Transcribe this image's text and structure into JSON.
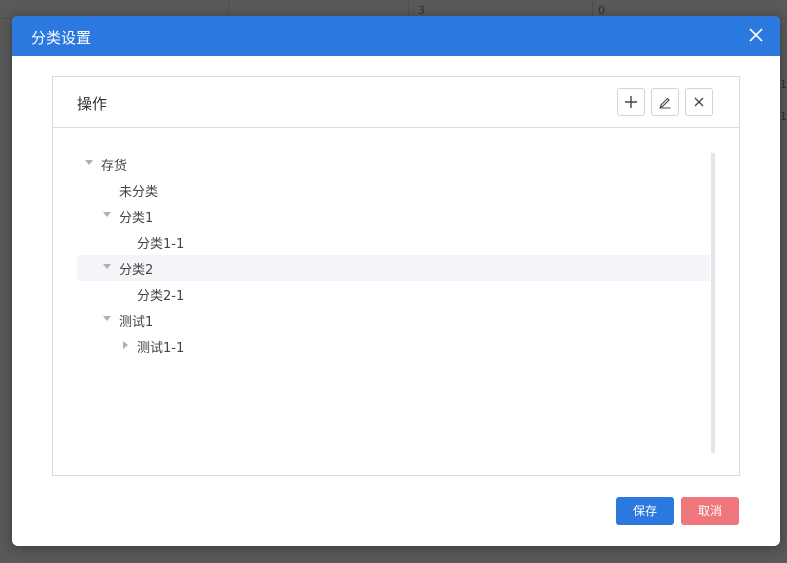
{
  "background": {
    "cells": [
      "3",
      "0",
      "1",
      "1"
    ]
  },
  "dialog": {
    "title": "分类设置",
    "panel_title": "操作",
    "toolbar": {
      "add_icon": "plus-icon",
      "edit_icon": "pencil-icon",
      "delete_icon": "close-icon"
    },
    "tree": [
      {
        "label": "存货",
        "level": 0,
        "toggle": "expanded",
        "highlighted": false
      },
      {
        "label": "未分类",
        "level": 1,
        "toggle": "none",
        "highlighted": false
      },
      {
        "label": "分类1",
        "level": 1,
        "toggle": "expanded",
        "highlighted": false
      },
      {
        "label": "分类1-1",
        "level": 2,
        "toggle": "none",
        "highlighted": false
      },
      {
        "label": "分类2",
        "level": 1,
        "toggle": "expanded",
        "highlighted": true
      },
      {
        "label": "分类2-1",
        "level": 2,
        "toggle": "none",
        "highlighted": false
      },
      {
        "label": "测试1",
        "level": 1,
        "toggle": "expanded",
        "highlighted": false
      },
      {
        "label": "测试1-1",
        "level": 2,
        "toggle": "collapsed",
        "highlighted": false
      }
    ],
    "save_label": "保存",
    "cancel_label": "取消"
  },
  "colors": {
    "header": "#2b78de",
    "save": "#2b78de",
    "cancel": "#ef767a",
    "row_highlight": "#f4f5f8"
  }
}
